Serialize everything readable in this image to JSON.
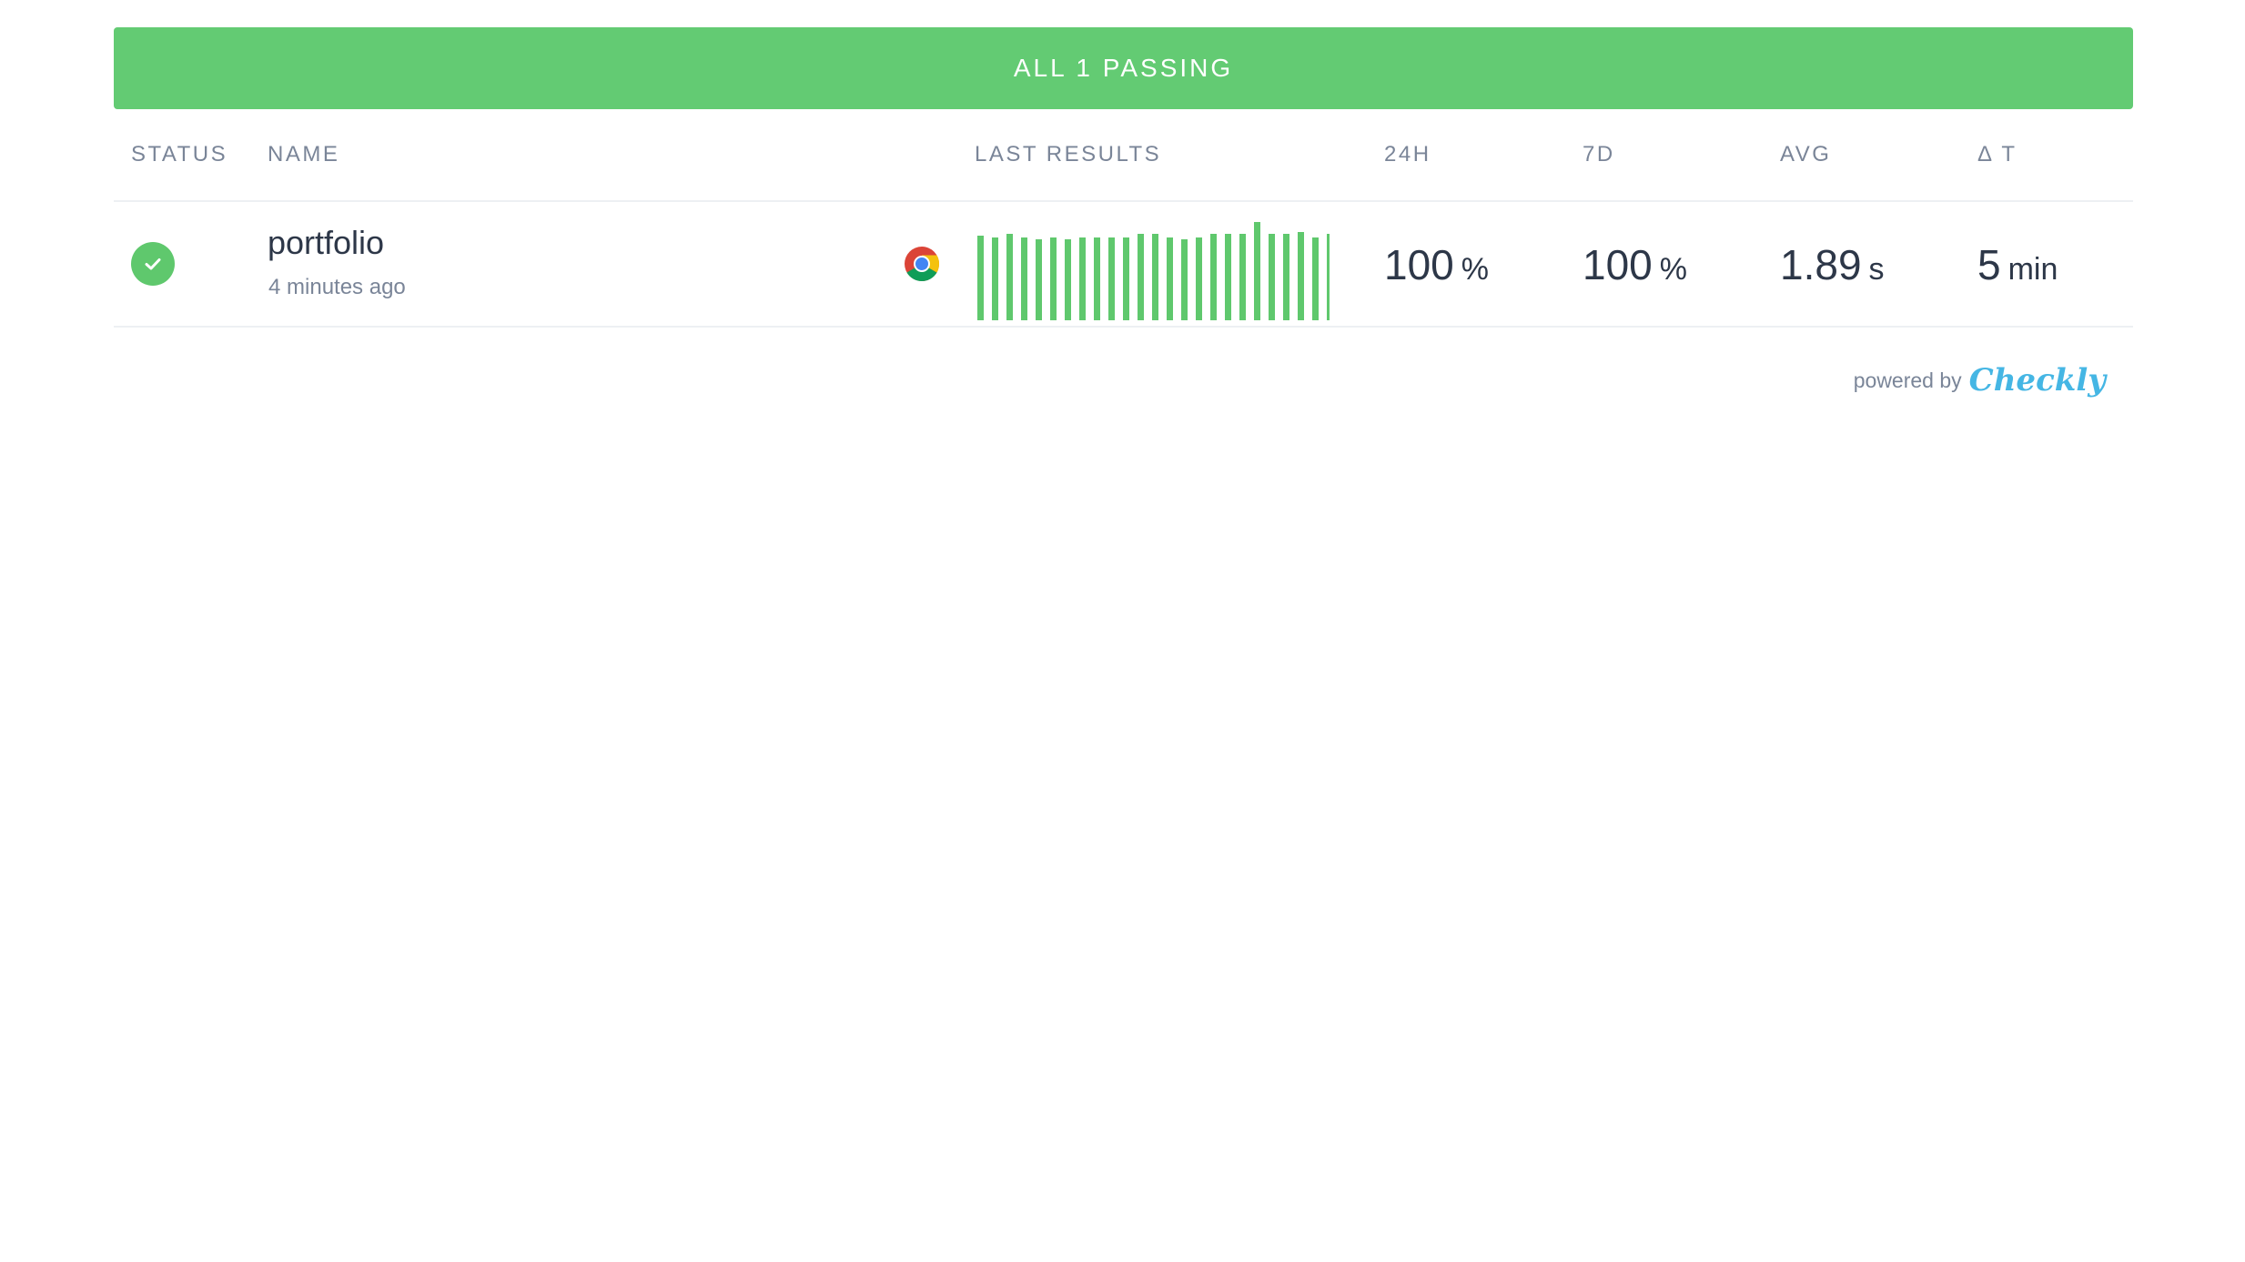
{
  "banner": {
    "text": "ALL 1 PASSING"
  },
  "columns": {
    "status": "STATUS",
    "name": "NAME",
    "last_results": "LAST RESULTS",
    "h24": "24H",
    "d7": "7D",
    "avg": "AVG",
    "delta_t": "Δ T"
  },
  "check": {
    "status": "passing",
    "name": "portfolio",
    "last_run": "4 minutes ago",
    "browser_icon": "chrome-icon",
    "results": [
      0.86,
      0.84,
      0.88,
      0.84,
      0.82,
      0.84,
      0.82,
      0.84,
      0.84,
      0.84,
      0.84,
      0.88,
      0.88,
      0.84,
      0.82,
      0.84,
      0.88,
      0.88,
      0.88,
      1.0,
      0.88,
      0.88,
      0.9,
      0.84,
      0.88,
      0.82
    ],
    "uptime_24h": {
      "value": "100",
      "unit": "%"
    },
    "uptime_7d": {
      "value": "100",
      "unit": "%"
    },
    "avg": {
      "value": "1.89",
      "unit": "s"
    },
    "delta_t": {
      "value": "5",
      "unit": "min"
    }
  },
  "footer": {
    "powered_by": "powered by",
    "brand": "Checkly"
  },
  "colors": {
    "passing": "#63cb73",
    "bar": "#5fc86d",
    "brand": "#45b6e4"
  }
}
